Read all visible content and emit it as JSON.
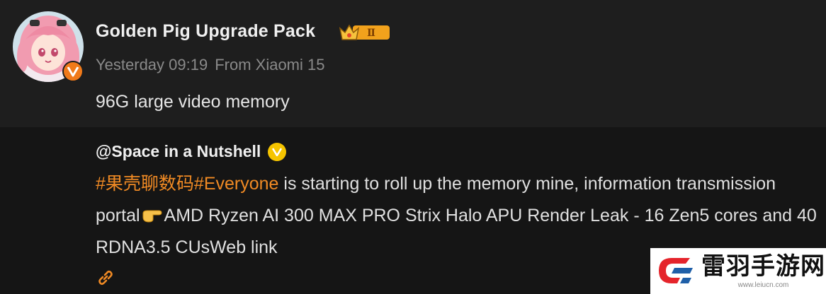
{
  "post": {
    "username": "Golden Pig Upgrade Pack",
    "level_badge": "Ⅱ",
    "timestamp": "Yesterday 09:19",
    "source": "From Xiaomi 15",
    "text": "96G large video memory",
    "avatar_icon": "anime-avatar",
    "verified_icon": "v-badge-orange",
    "crown_icon": "crown-level-icon"
  },
  "quoted": {
    "username": "@Space in a Nutshell",
    "verified_icon": "v-badge-gold",
    "tag1": "#果壳聊数码#",
    "tag2": "Everyone",
    "text1": " is starting to roll up the memory mine, information transmission portal",
    "pointing_emoji": "pointing-hand-icon",
    "text2": "AMD Ryzen AI 300 MAX PRO Strix Halo APU Render Leak - 16 Zen5 cores and 40 RDNA3.5 CUsWeb link",
    "link_icon": "link-icon"
  },
  "watermark": {
    "title": "雷羽手游网",
    "url": "www.leiucn.com"
  },
  "colors": {
    "background": "#1e1e1e",
    "quoted_background": "#151515",
    "accent_orange": "#f08a24",
    "gold": "#f5c400",
    "meta_gray": "#8a8a8a"
  }
}
